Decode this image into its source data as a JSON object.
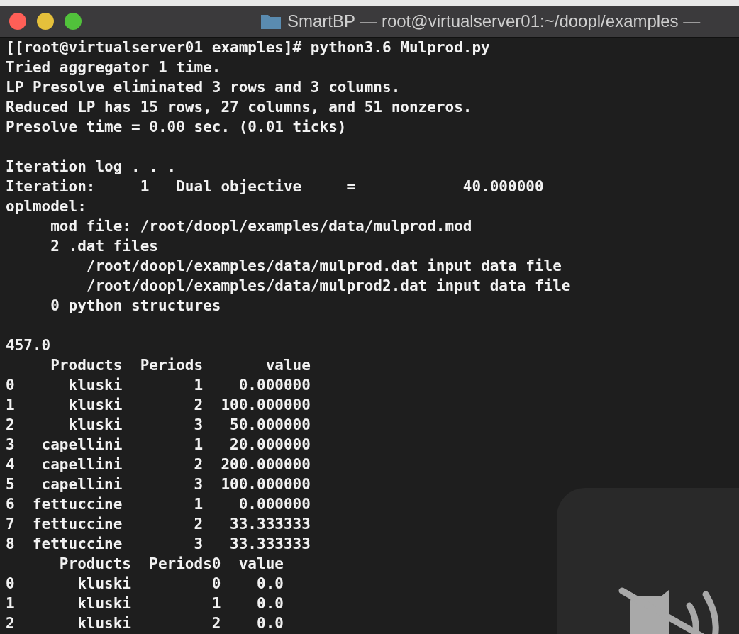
{
  "window": {
    "title": "SmartBP — root@virtualserver01:~/doopl/examples —"
  },
  "terminal": {
    "blocks": [
      [
        "[[root@virtualserver01 examples]# python3.6 Mulprod.py",
        "Tried aggregator 1 time.",
        "LP Presolve eliminated 3 rows and 3 columns.",
        "Reduced LP has 15 rows, 27 columns, and 51 nonzeros.",
        "Presolve time = 0.00 sec. (0.01 ticks)"
      ],
      [
        "Iteration log . . .",
        "Iteration:     1   Dual objective     =            40.000000",
        "oplmodel:",
        "     mod file: /root/doopl/examples/data/mulprod.mod",
        "     2 .dat files",
        "         /root/doopl/examples/data/mulprod.dat input data file",
        "         /root/doopl/examples/data/mulprod2.dat input data file",
        "     0 python structures"
      ],
      [
        "457.0",
        "     Products  Periods       value",
        "0      kluski        1    0.000000",
        "1      kluski        2  100.000000",
        "2      kluski        3   50.000000",
        "3   capellini        1   20.000000",
        "4   capellini        2  200.000000",
        "5   capellini        3  100.000000",
        "6  fettuccine        1    0.000000",
        "7  fettuccine        2   33.333333",
        "8  fettuccine        3   33.333333",
        "      Products  Periods0  value",
        "0       kluski         0    0.0",
        "1       kluski         1    0.0",
        "2       kluski         2    0.0"
      ]
    ]
  },
  "overlay": {
    "kind": "mute"
  }
}
